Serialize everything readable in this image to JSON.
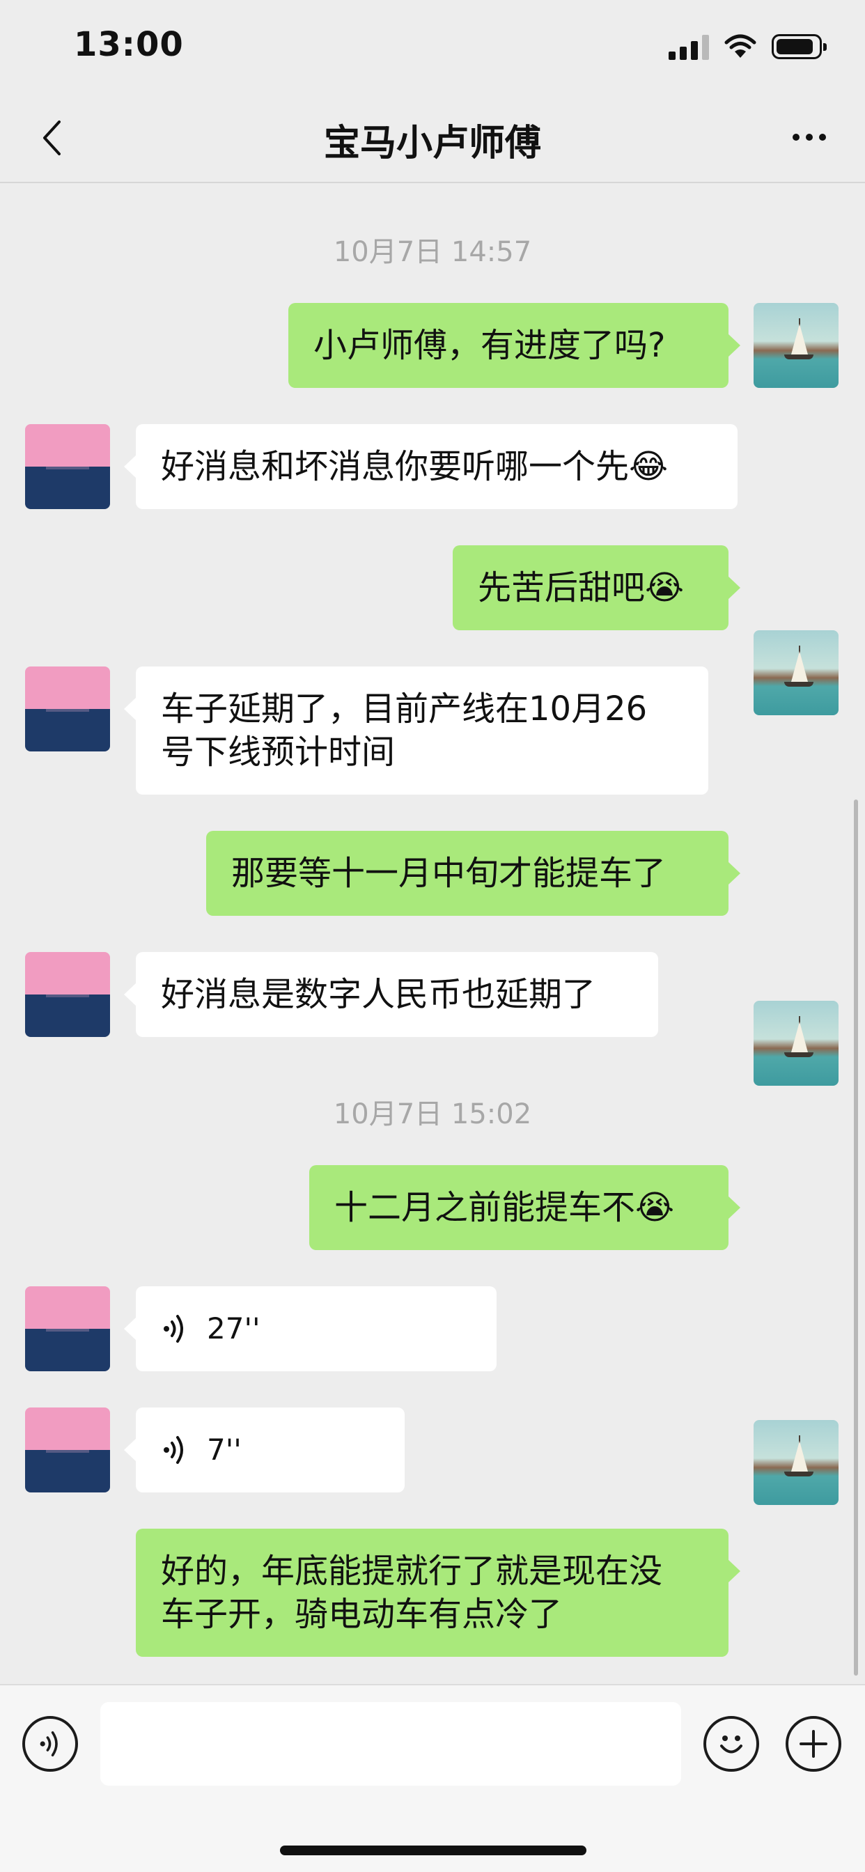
{
  "status_bar": {
    "time": "13:00"
  },
  "header": {
    "title": "宝马小卢师傅"
  },
  "timestamps": [
    "10月7日 14:57",
    "10月7日 15:02"
  ],
  "messages": [
    {
      "from": "me",
      "text": "小卢师傅，有进度了吗?"
    },
    {
      "from": "friend",
      "text": "好消息和坏消息你要听哪一个先😂"
    },
    {
      "from": "me",
      "text": "先苦后甜吧😭"
    },
    {
      "from": "friend",
      "text": "车子延期了，目前产线在10月26\n号下线预计时间"
    },
    {
      "from": "me",
      "text": "那要等十一月中旬才能提车了"
    },
    {
      "from": "friend",
      "text": "好消息是数字人民币也延期了"
    },
    {
      "from": "me",
      "text": "十二月之前能提车不😭"
    },
    {
      "from": "friend",
      "type": "voice",
      "duration": "27''"
    },
    {
      "from": "friend",
      "type": "voice",
      "duration": "7''"
    },
    {
      "from": "me",
      "text": "好的，年底能提就行了就是现在没\n车子开，骑电动车有点冷了"
    }
  ],
  "colors": {
    "out_bubble": "#a9e97b",
    "in_bubble": "#ffffff",
    "background": "#ededed"
  },
  "icons": [
    "back-arrow-icon",
    "more-icon",
    "voice-input-icon",
    "emoji-icon",
    "plus-icon"
  ]
}
